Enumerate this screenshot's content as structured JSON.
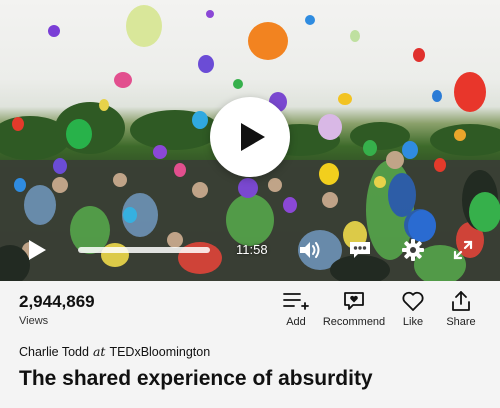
{
  "player": {
    "duration": "11:58",
    "progress_fraction": 0,
    "icons": {
      "big_play": "play-icon",
      "small_play": "play-icon",
      "volume": "volume-icon",
      "subtitles": "subtitles-icon",
      "settings": "gear-icon",
      "fullscreen": "fullscreen-icon"
    }
  },
  "stats": {
    "views_count": "2,944,869",
    "views_label": "Views"
  },
  "actions": [
    {
      "label": "Add",
      "icon": "add-to-list-icon"
    },
    {
      "label": "Recommend",
      "icon": "recommend-icon"
    },
    {
      "label": "Like",
      "icon": "heart-icon"
    },
    {
      "label": "Share",
      "icon": "share-icon"
    }
  ],
  "talk": {
    "speaker": "Charlie Todd",
    "at": "at",
    "event": "TEDxBloomington",
    "title": "The shared experience of absurdity"
  },
  "colors": {
    "accent": "#e62b1e",
    "text": "#111111",
    "background": "#f4f4f4"
  }
}
